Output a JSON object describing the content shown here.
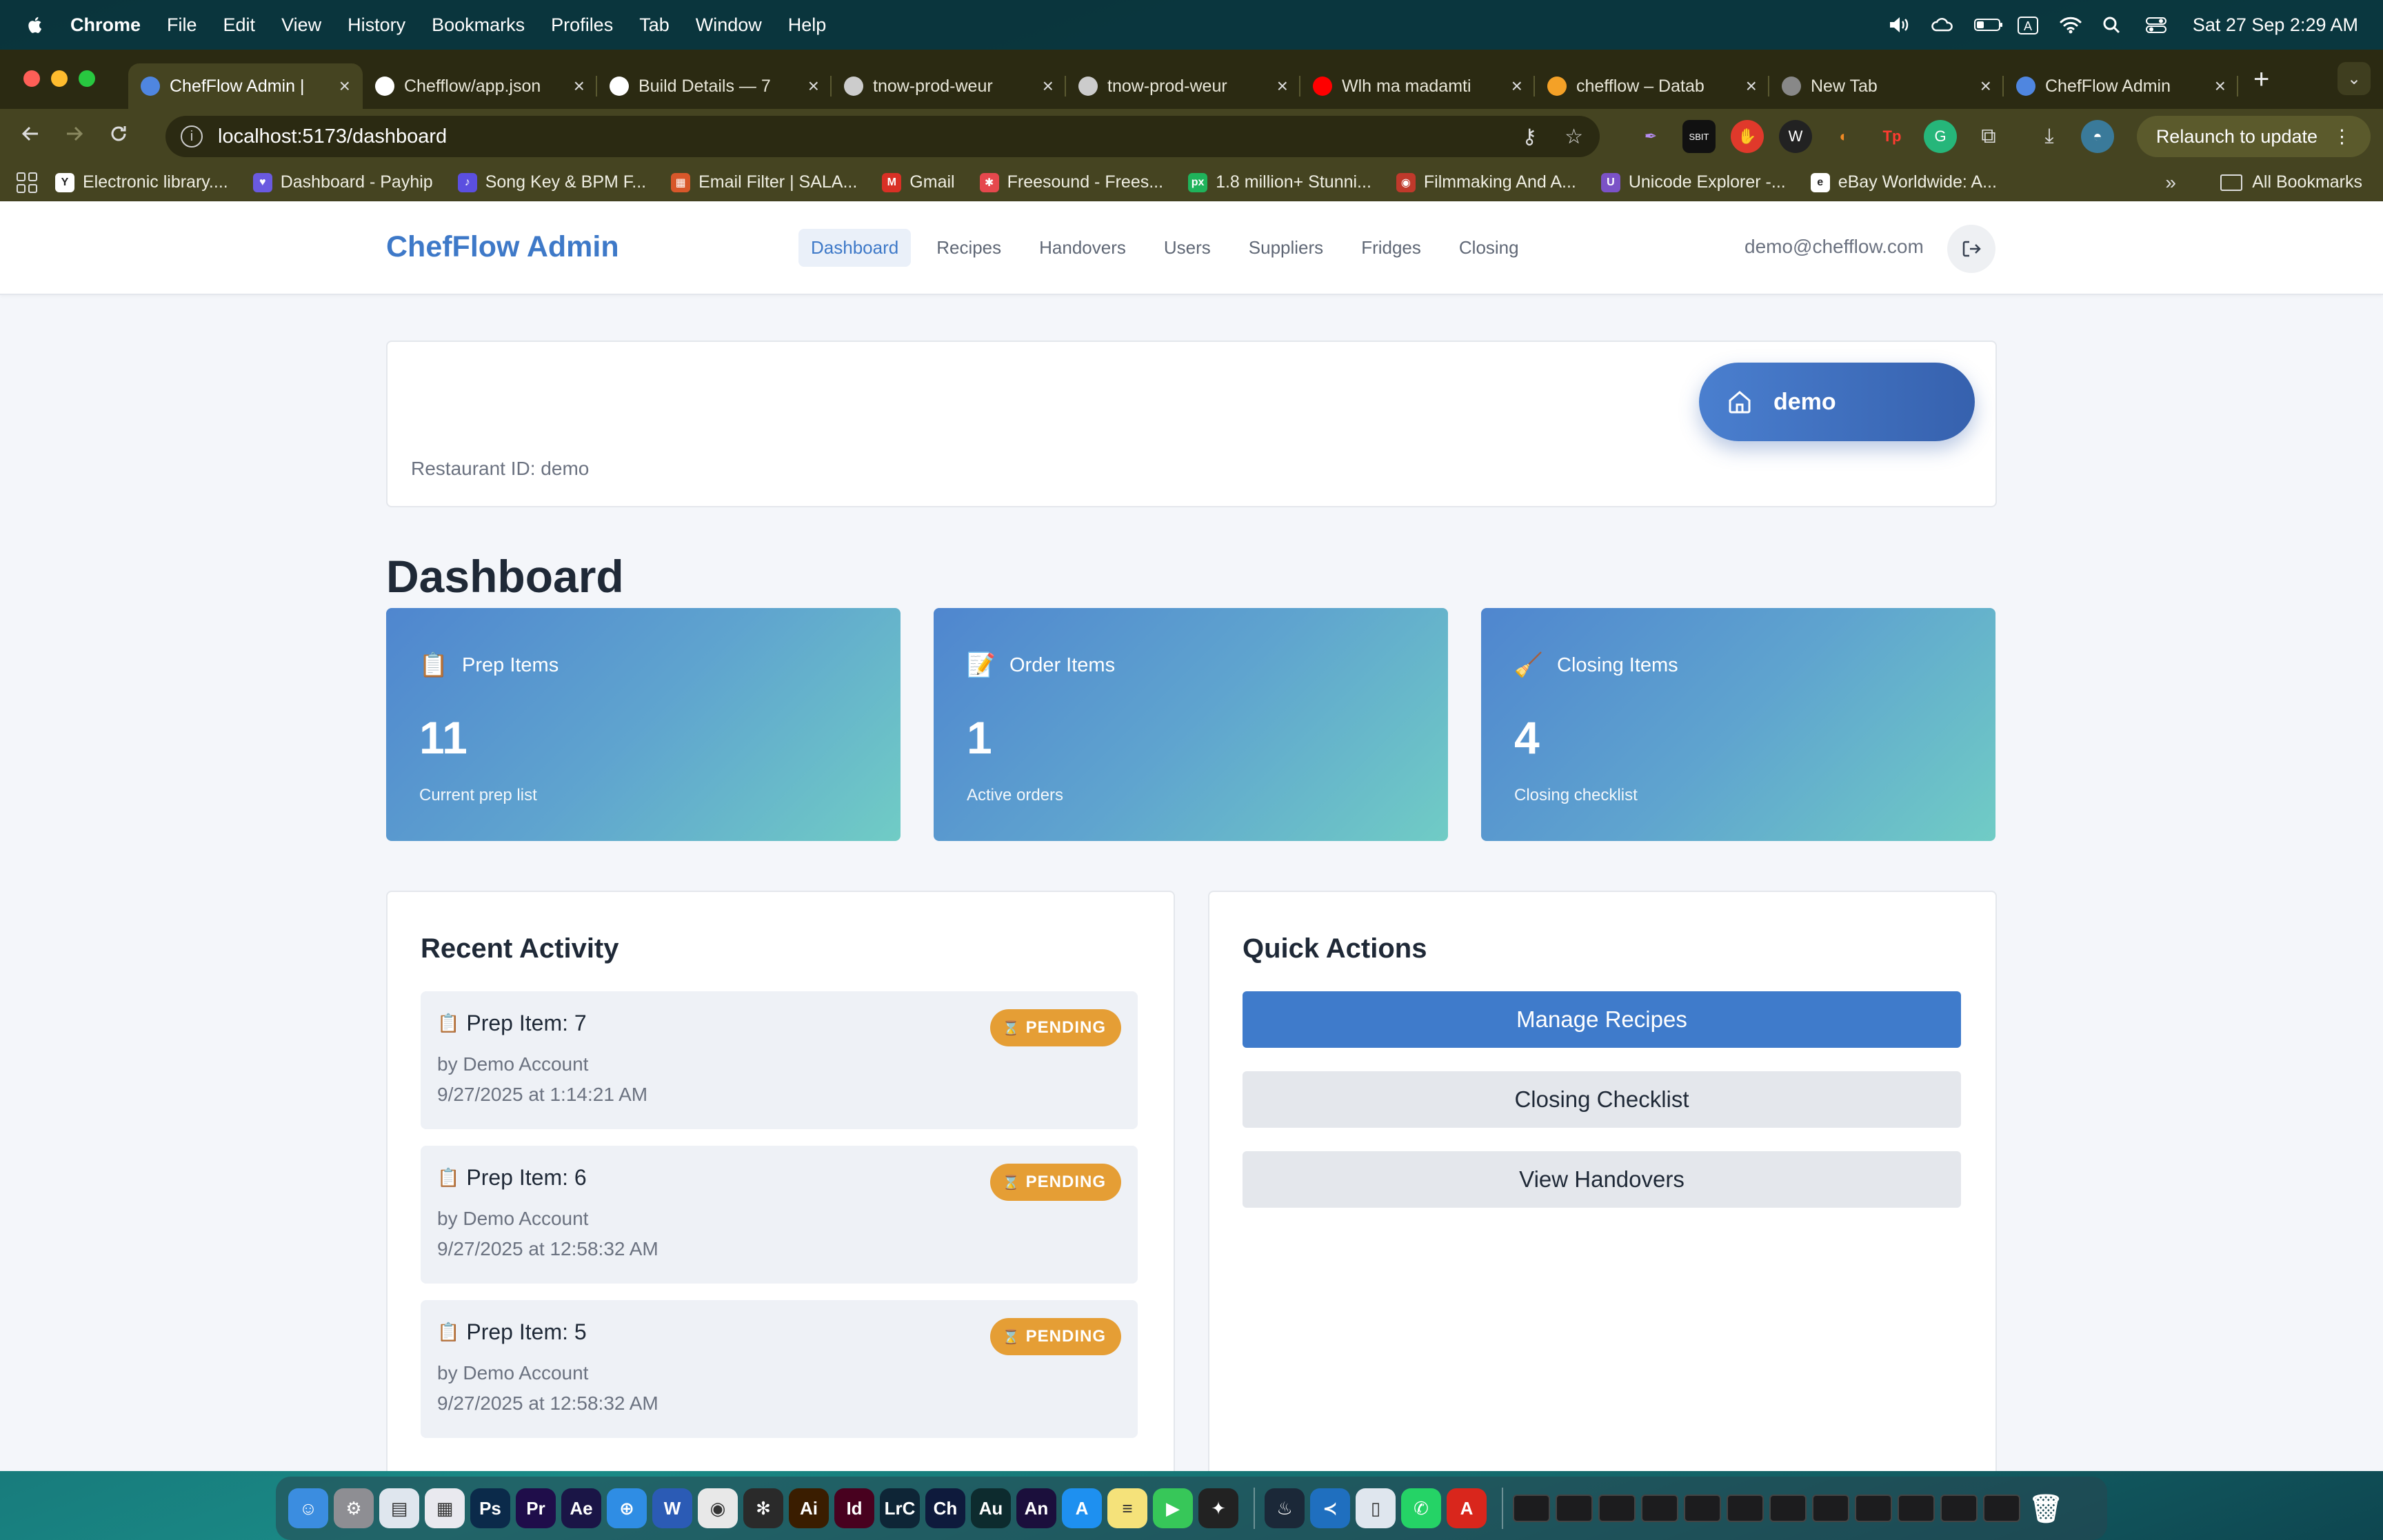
{
  "menubar": {
    "app": "Chrome",
    "items": [
      "File",
      "Edit",
      "View",
      "History",
      "Bookmarks",
      "Profiles",
      "Tab",
      "Window",
      "Help"
    ],
    "input_source": "A",
    "clock": "Sat 27 Sep  2:29 AM"
  },
  "browser": {
    "tabs": [
      {
        "title": "ChefFlow Admin |",
        "favicon": "chef-hat-icon",
        "color": "#4f86e0",
        "active": true
      },
      {
        "title": "Chefflow/app.json",
        "favicon": "github-icon",
        "color": "#ffffff",
        "active": false
      },
      {
        "title": "Build Details — 7",
        "favicon": "expo-icon",
        "color": "#ffffff",
        "active": false
      },
      {
        "title": "tnow-prod-weur",
        "favicon": "globe-icon",
        "color": "#cccccc",
        "active": false
      },
      {
        "title": "tnow-prod-weur",
        "favicon": "globe-icon",
        "color": "#cccccc",
        "active": false
      },
      {
        "title": "Wlh ma madamti",
        "favicon": "youtube-icon",
        "color": "#ff0000",
        "active": false
      },
      {
        "title": "chefflow – Datab",
        "favicon": "firebase-icon",
        "color": "#f4a127",
        "active": false
      },
      {
        "title": "New Tab",
        "favicon": "chrome-icon",
        "color": "#888888",
        "active": false
      },
      {
        "title": "ChefFlow Admin",
        "favicon": "chef-hat-icon",
        "color": "#4f86e0",
        "active": false
      }
    ],
    "url": "localhost:5173/dashboard",
    "relaunch_label": "Relaunch to update",
    "bookmarks": [
      {
        "label": "Electronic library....",
        "icon": "Y",
        "color": "#ffffff"
      },
      {
        "label": "Dashboard - Payhip",
        "icon": "♥",
        "color": "#6a5ae0"
      },
      {
        "label": "Song Key & BPM F...",
        "icon": "♪",
        "color": "#5b4fe0"
      },
      {
        "label": "Email Filter | SALA...",
        "icon": "▦",
        "color": "#d8572a"
      },
      {
        "label": "Gmail",
        "icon": "M",
        "color": "#d93025"
      },
      {
        "label": "Freesound - Frees...",
        "icon": "✱",
        "color": "#e5484d"
      },
      {
        "label": "1.8 million+ Stunni...",
        "icon": "px",
        "color": "#1fb35b"
      },
      {
        "label": "Filmmaking And A...",
        "icon": "◉",
        "color": "#c0392b"
      },
      {
        "label": "Unicode Explorer -...",
        "icon": "U",
        "color": "#7b52c7"
      },
      {
        "label": "eBay Worldwide: A...",
        "icon": "e",
        "color": "#ffffff"
      }
    ],
    "all_bookmarks_label": "All Bookmarks"
  },
  "app": {
    "brand": "ChefFlow Admin",
    "nav": [
      "Dashboard",
      "Recipes",
      "Handovers",
      "Users",
      "Suppliers",
      "Fridges",
      "Closing"
    ],
    "active_nav": "Dashboard",
    "user_email": "demo@chefflow.com",
    "restaurant_label": "Restaurant ID: demo",
    "restaurant_pill": "demo",
    "page_title": "Dashboard",
    "stats": [
      {
        "emoji": "📋",
        "label": "Prep Items",
        "value": "11",
        "sub": "Current prep list"
      },
      {
        "emoji": "📝",
        "label": "Order Items",
        "value": "1",
        "sub": "Active orders"
      },
      {
        "emoji": "🧹",
        "label": "Closing Items",
        "value": "4",
        "sub": "Closing checklist"
      }
    ],
    "recent_activity": {
      "title": "Recent Activity",
      "items": [
        {
          "title": "Prep Item: 7",
          "by": "by Demo Account",
          "date": "9/27/2025 at 1:14:21 AM",
          "status": "PENDING"
        },
        {
          "title": "Prep Item: 6",
          "by": "by Demo Account",
          "date": "9/27/2025 at 12:58:32 AM",
          "status": "PENDING"
        },
        {
          "title": "Prep Item: 5",
          "by": "by Demo Account",
          "date": "9/27/2025 at 12:58:32 AM",
          "status": "PENDING"
        }
      ]
    },
    "quick_actions": {
      "title": "Quick Actions",
      "buttons": [
        "Manage Recipes",
        "Closing Checklist",
        "View Handovers"
      ]
    },
    "colors": {
      "accent": "#3e79c8",
      "pending": "#e59e35",
      "stat_gradient_start": "#4f86cf",
      "stat_gradient_end": "#70ccc5"
    }
  },
  "dock": {
    "apps": [
      {
        "icon": "finder-icon",
        "label": "☺",
        "color": "#3b8de0"
      },
      {
        "icon": "system-settings-icon",
        "label": "⚙",
        "color": "#8e8e93"
      },
      {
        "icon": "preview-icon",
        "label": "▤",
        "color": "#dfe6ee"
      },
      {
        "icon": "launchpad-icon",
        "label": "▦",
        "color": "#e9e9ef"
      },
      {
        "icon": "photoshop-icon",
        "label": "Ps",
        "color": "#0b2a4a"
      },
      {
        "icon": "premiere-icon",
        "label": "Pr",
        "color": "#1f0d4a"
      },
      {
        "icon": "after-effects-icon",
        "label": "Ae",
        "color": "#1a1546"
      },
      {
        "icon": "safari-icon",
        "label": "⊕",
        "color": "#2f8de4"
      },
      {
        "icon": "word-icon",
        "label": "W",
        "color": "#2b5bb5"
      },
      {
        "icon": "chrome-icon",
        "label": "◉",
        "color": "#e8e8e8"
      },
      {
        "icon": "davinci-icon",
        "label": "✻",
        "color": "#2a2a2a"
      },
      {
        "icon": "illustrator-icon",
        "label": "Ai",
        "color": "#3a1d00"
      },
      {
        "icon": "indesign-icon",
        "label": "Id",
        "color": "#48011f"
      },
      {
        "icon": "lightroom-classic-icon",
        "label": "LrC",
        "color": "#0e2536"
      },
      {
        "icon": "character-animator-icon",
        "label": "Ch",
        "color": "#0e1a3c"
      },
      {
        "icon": "audition-icon",
        "label": "Au",
        "color": "#0d2b2e"
      },
      {
        "icon": "animate-icon",
        "label": "An",
        "color": "#1b0f3c"
      },
      {
        "icon": "app-store-icon",
        "label": "A",
        "color": "#1e90f0"
      },
      {
        "icon": "notes-icon",
        "label": "≡",
        "color": "#f5e27a"
      },
      {
        "icon": "facetime-icon",
        "label": "▶",
        "color": "#37c759"
      },
      {
        "icon": "figma-icon",
        "label": "✦",
        "color": "#222222"
      }
    ],
    "apps2": [
      {
        "icon": "steam-icon",
        "label": "♨",
        "color": "#1b2838"
      },
      {
        "icon": "vscode-icon",
        "label": "≺",
        "color": "#1f6fbf"
      },
      {
        "icon": "xcode-simulator-icon",
        "label": "▯",
        "color": "#dfe6ee"
      },
      {
        "icon": "whatsapp-icon",
        "label": "✆",
        "color": "#25d366"
      },
      {
        "icon": "acrobat-icon",
        "label": "A",
        "color": "#d9261c"
      }
    ],
    "minimized_count": 12
  }
}
